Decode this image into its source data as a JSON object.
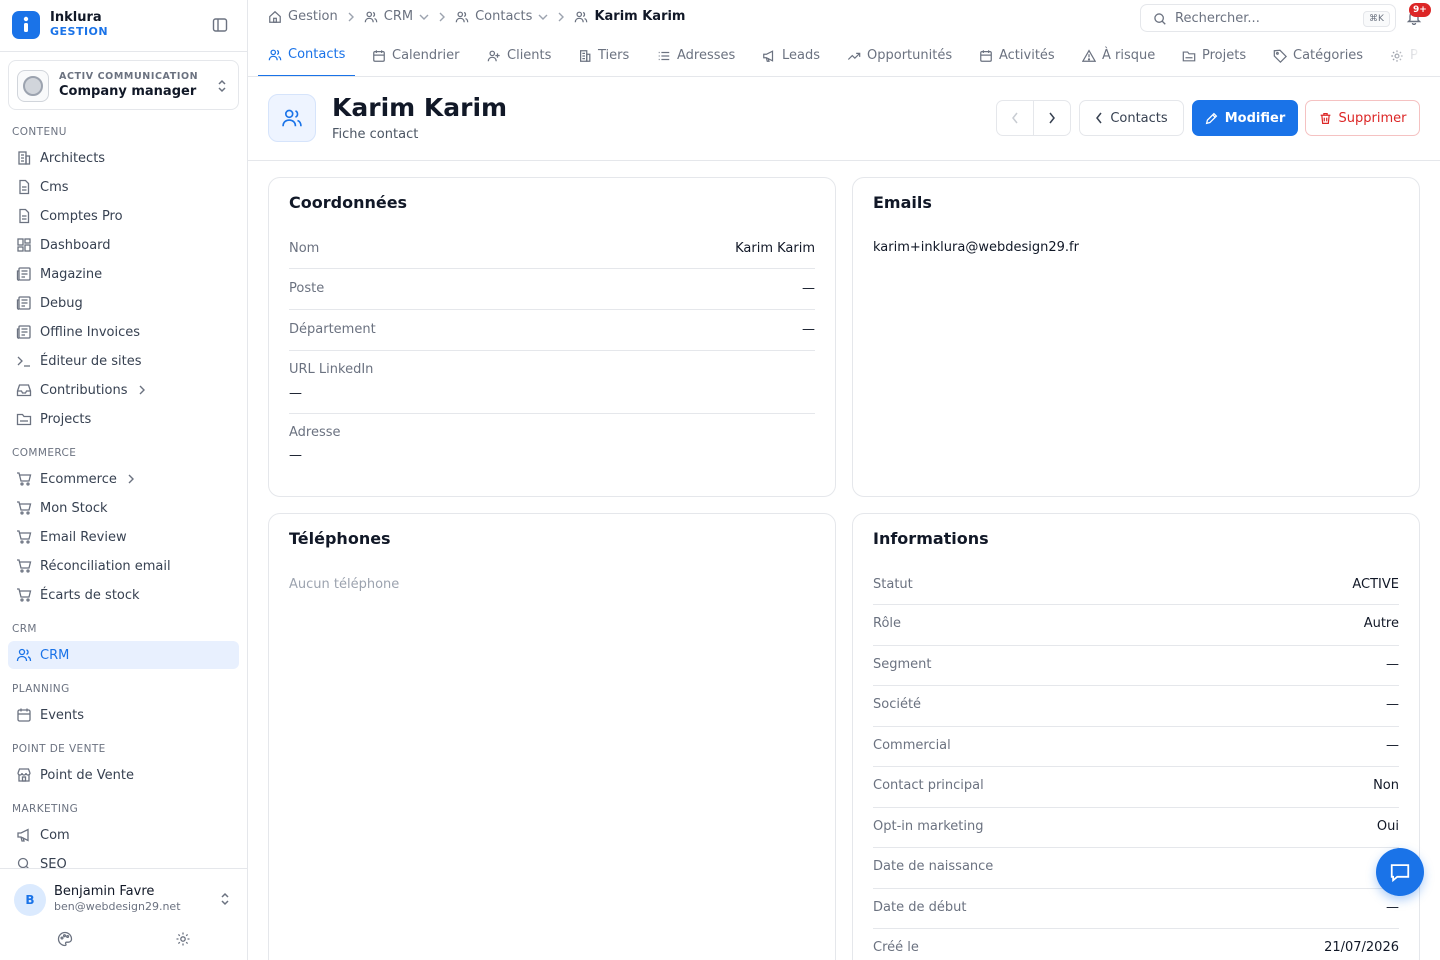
{
  "brand": {
    "name": "Inklura",
    "subtitle": "GESTION"
  },
  "company": {
    "tag": "ACTIV COMMUNICATION",
    "name": "Company manager"
  },
  "sidebar": {
    "sections": [
      {
        "title": "CONTENU",
        "items": [
          "Architects",
          "Cms",
          "Comptes Pro",
          "Dashboard",
          "Magazine",
          "Debug",
          "Offline Invoices",
          "Éditeur de sites",
          "Contributions",
          "Projects"
        ]
      },
      {
        "title": "COMMERCE",
        "items": [
          "Ecommerce",
          "Mon Stock",
          "Email Review",
          "Réconciliation email",
          "Écarts de stock"
        ]
      },
      {
        "title": "CRM",
        "items": [
          "CRM"
        ]
      },
      {
        "title": "PLANNING",
        "items": [
          "Events"
        ]
      },
      {
        "title": "POINT DE VENTE",
        "items": [
          "Point de Vente"
        ]
      },
      {
        "title": "MARKETING",
        "items": [
          "Com",
          "SEO"
        ]
      }
    ],
    "active_item": "CRM"
  },
  "user": {
    "initial": "B",
    "name": "Benjamin Favre",
    "email": "ben@webdesign29.net"
  },
  "breadcrumb": [
    "Gestion",
    "CRM",
    "Contacts",
    "Karim Karim"
  ],
  "search": {
    "placeholder": "Rechercher...",
    "shortcut": "⌘K"
  },
  "notifications": {
    "badge": "9+"
  },
  "tabs": [
    "Contacts",
    "Calendrier",
    "Clients",
    "Tiers",
    "Adresses",
    "Leads",
    "Opportunités",
    "Activités",
    "À risque",
    "Projets",
    "Catégories",
    "P"
  ],
  "active_tab": "Contacts",
  "header": {
    "title": "Karim Karim",
    "subtitle": "Fiche contact",
    "back_label": "Contacts",
    "edit_label": "Modifier",
    "delete_label": "Supprimer"
  },
  "coordonnees": {
    "title": "Coordonnées",
    "rows": [
      {
        "label": "Nom",
        "value": "Karim Karim"
      },
      {
        "label": "Poste",
        "value": "—"
      },
      {
        "label": "Département",
        "value": "—"
      },
      {
        "label": "URL LinkedIn",
        "value": "—"
      },
      {
        "label": "Adresse",
        "value": "—"
      }
    ]
  },
  "emails": {
    "title": "Emails",
    "items": [
      "karim+inklura@webdesign29.fr"
    ]
  },
  "telephones": {
    "title": "Téléphones",
    "empty": "Aucun téléphone"
  },
  "informations": {
    "title": "Informations",
    "rows": [
      {
        "label": "Statut",
        "value": "ACTIVE"
      },
      {
        "label": "Rôle",
        "value": "Autre"
      },
      {
        "label": "Segment",
        "value": "—"
      },
      {
        "label": "Société",
        "value": "—"
      },
      {
        "label": "Commercial",
        "value": "—"
      },
      {
        "label": "Contact principal",
        "value": "Non"
      },
      {
        "label": "Opt-in marketing",
        "value": "Oui"
      },
      {
        "label": "Date de naissance",
        "value": ""
      },
      {
        "label": "Date de début",
        "value": "—"
      },
      {
        "label": "Créé le",
        "value": "21/07/2026"
      }
    ]
  },
  "colors": {
    "accent": "#1a73e8",
    "danger": "#dc2626"
  }
}
